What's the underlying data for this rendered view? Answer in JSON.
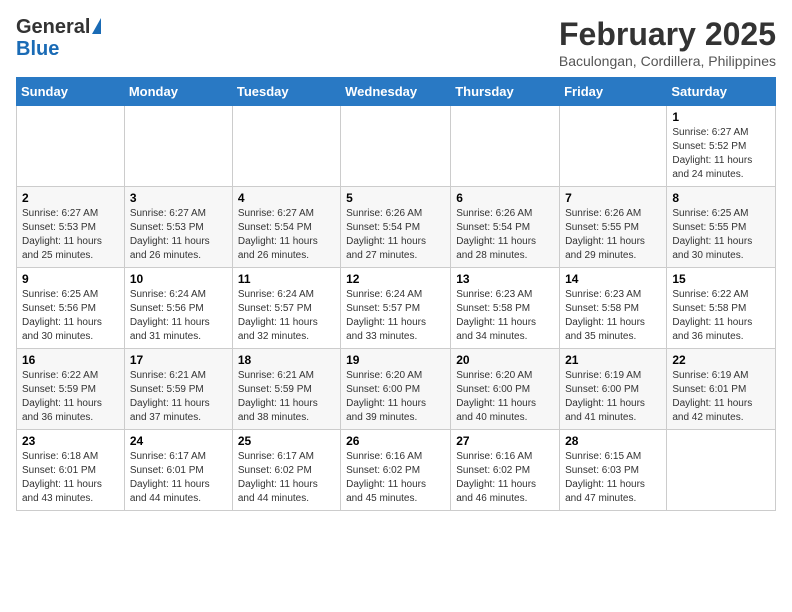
{
  "logo": {
    "general": "General",
    "blue": "Blue"
  },
  "title": "February 2025",
  "subtitle": "Baculongan, Cordillera, Philippines",
  "days_of_week": [
    "Sunday",
    "Monday",
    "Tuesday",
    "Wednesday",
    "Thursday",
    "Friday",
    "Saturday"
  ],
  "weeks": [
    [
      {
        "day": "",
        "info": ""
      },
      {
        "day": "",
        "info": ""
      },
      {
        "day": "",
        "info": ""
      },
      {
        "day": "",
        "info": ""
      },
      {
        "day": "",
        "info": ""
      },
      {
        "day": "",
        "info": ""
      },
      {
        "day": "1",
        "info": "Sunrise: 6:27 AM\nSunset: 5:52 PM\nDaylight: 11 hours and 24 minutes."
      }
    ],
    [
      {
        "day": "2",
        "info": "Sunrise: 6:27 AM\nSunset: 5:53 PM\nDaylight: 11 hours and 25 minutes."
      },
      {
        "day": "3",
        "info": "Sunrise: 6:27 AM\nSunset: 5:53 PM\nDaylight: 11 hours and 26 minutes."
      },
      {
        "day": "4",
        "info": "Sunrise: 6:27 AM\nSunset: 5:54 PM\nDaylight: 11 hours and 26 minutes."
      },
      {
        "day": "5",
        "info": "Sunrise: 6:26 AM\nSunset: 5:54 PM\nDaylight: 11 hours and 27 minutes."
      },
      {
        "day": "6",
        "info": "Sunrise: 6:26 AM\nSunset: 5:54 PM\nDaylight: 11 hours and 28 minutes."
      },
      {
        "day": "7",
        "info": "Sunrise: 6:26 AM\nSunset: 5:55 PM\nDaylight: 11 hours and 29 minutes."
      },
      {
        "day": "8",
        "info": "Sunrise: 6:25 AM\nSunset: 5:55 PM\nDaylight: 11 hours and 30 minutes."
      }
    ],
    [
      {
        "day": "9",
        "info": "Sunrise: 6:25 AM\nSunset: 5:56 PM\nDaylight: 11 hours and 30 minutes."
      },
      {
        "day": "10",
        "info": "Sunrise: 6:24 AM\nSunset: 5:56 PM\nDaylight: 11 hours and 31 minutes."
      },
      {
        "day": "11",
        "info": "Sunrise: 6:24 AM\nSunset: 5:57 PM\nDaylight: 11 hours and 32 minutes."
      },
      {
        "day": "12",
        "info": "Sunrise: 6:24 AM\nSunset: 5:57 PM\nDaylight: 11 hours and 33 minutes."
      },
      {
        "day": "13",
        "info": "Sunrise: 6:23 AM\nSunset: 5:58 PM\nDaylight: 11 hours and 34 minutes."
      },
      {
        "day": "14",
        "info": "Sunrise: 6:23 AM\nSunset: 5:58 PM\nDaylight: 11 hours and 35 minutes."
      },
      {
        "day": "15",
        "info": "Sunrise: 6:22 AM\nSunset: 5:58 PM\nDaylight: 11 hours and 36 minutes."
      }
    ],
    [
      {
        "day": "16",
        "info": "Sunrise: 6:22 AM\nSunset: 5:59 PM\nDaylight: 11 hours and 36 minutes."
      },
      {
        "day": "17",
        "info": "Sunrise: 6:21 AM\nSunset: 5:59 PM\nDaylight: 11 hours and 37 minutes."
      },
      {
        "day": "18",
        "info": "Sunrise: 6:21 AM\nSunset: 5:59 PM\nDaylight: 11 hours and 38 minutes."
      },
      {
        "day": "19",
        "info": "Sunrise: 6:20 AM\nSunset: 6:00 PM\nDaylight: 11 hours and 39 minutes."
      },
      {
        "day": "20",
        "info": "Sunrise: 6:20 AM\nSunset: 6:00 PM\nDaylight: 11 hours and 40 minutes."
      },
      {
        "day": "21",
        "info": "Sunrise: 6:19 AM\nSunset: 6:00 PM\nDaylight: 11 hours and 41 minutes."
      },
      {
        "day": "22",
        "info": "Sunrise: 6:19 AM\nSunset: 6:01 PM\nDaylight: 11 hours and 42 minutes."
      }
    ],
    [
      {
        "day": "23",
        "info": "Sunrise: 6:18 AM\nSunset: 6:01 PM\nDaylight: 11 hours and 43 minutes."
      },
      {
        "day": "24",
        "info": "Sunrise: 6:17 AM\nSunset: 6:01 PM\nDaylight: 11 hours and 44 minutes."
      },
      {
        "day": "25",
        "info": "Sunrise: 6:17 AM\nSunset: 6:02 PM\nDaylight: 11 hours and 44 minutes."
      },
      {
        "day": "26",
        "info": "Sunrise: 6:16 AM\nSunset: 6:02 PM\nDaylight: 11 hours and 45 minutes."
      },
      {
        "day": "27",
        "info": "Sunrise: 6:16 AM\nSunset: 6:02 PM\nDaylight: 11 hours and 46 minutes."
      },
      {
        "day": "28",
        "info": "Sunrise: 6:15 AM\nSunset: 6:03 PM\nDaylight: 11 hours and 47 minutes."
      },
      {
        "day": "",
        "info": ""
      }
    ]
  ]
}
